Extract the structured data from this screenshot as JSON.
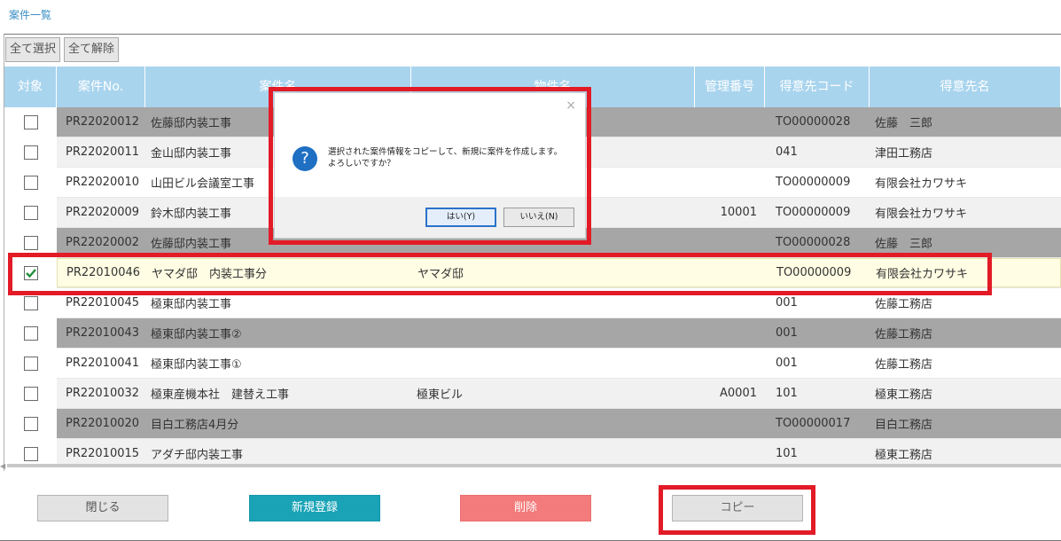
{
  "page_title": "案件一覧",
  "toolbar": {
    "select_all": "全て選択",
    "deselect_all": "全て解除"
  },
  "columns": [
    "対象",
    "案件No.",
    "案件名",
    "物件名",
    "管理番号",
    "得意先コード",
    "得意先名"
  ],
  "rows": [
    {
      "no": "PR22020012",
      "name": "佐藤邸内装工事",
      "property": "",
      "mgmt": "",
      "code": "TO00000028",
      "customer": "佐藤　三郎",
      "checked": false,
      "style": "dark"
    },
    {
      "no": "PR22020011",
      "name": "金山邸内装工事",
      "property": "",
      "mgmt": "",
      "code": "041",
      "customer": "津田工務店",
      "checked": false,
      "style": "light"
    },
    {
      "no": "PR22020010",
      "name": "山田ビル会議室工事",
      "property": "",
      "mgmt": "",
      "code": "TO00000009",
      "customer": "有限会社カワサキ",
      "checked": false,
      "style": "white"
    },
    {
      "no": "PR22020009",
      "name": "鈴木邸内装工事",
      "property": "",
      "mgmt": "10001",
      "code": "TO00000009",
      "customer": "有限会社カワサキ",
      "checked": false,
      "style": "light"
    },
    {
      "no": "PR22020002",
      "name": "佐藤邸内装工事",
      "property": "",
      "mgmt": "",
      "code": "TO00000028",
      "customer": "佐藤　三郎",
      "checked": false,
      "style": "dark"
    },
    {
      "no": "PR22010046",
      "name": "ヤマダ邸　内装工事分",
      "property": "ヤマダ邸",
      "mgmt": "",
      "code": "TO00000009",
      "customer": "有限会社カワサキ",
      "checked": true,
      "style": "sel"
    },
    {
      "no": "PR22010045",
      "name": "極東邸内装工事",
      "property": "",
      "mgmt": "",
      "code": "001",
      "customer": "佐藤工務店",
      "checked": false,
      "style": "white"
    },
    {
      "no": "PR22010043",
      "name": "極東邸内装工事②",
      "property": "",
      "mgmt": "",
      "code": "001",
      "customer": "佐藤工務店",
      "checked": false,
      "style": "dark"
    },
    {
      "no": "PR22010041",
      "name": "極東邸内装工事①",
      "property": "",
      "mgmt": "",
      "code": "001",
      "customer": "佐藤工務店",
      "checked": false,
      "style": "white"
    },
    {
      "no": "PR22010032",
      "name": "極東産機本社　建替え工事",
      "property": "極東ビル",
      "mgmt": "A0001",
      "code": "101",
      "customer": "極東工務店",
      "checked": false,
      "style": "light"
    },
    {
      "no": "PR22010020",
      "name": "目白工務店4月分",
      "property": "",
      "mgmt": "",
      "code": "TO00000017",
      "customer": "目白工務店",
      "checked": false,
      "style": "dark"
    },
    {
      "no": "PR22010015",
      "name": "アダチ邸内装工事",
      "property": "",
      "mgmt": "",
      "code": "101",
      "customer": "極東工務店",
      "checked": false,
      "style": "light"
    }
  ],
  "footer": {
    "close": "閉じる",
    "new": "新規登録",
    "delete": "削除",
    "copy": "コピー"
  },
  "dialog": {
    "message_line1": "選択された案件情報をコピーして、新規に案件を作成します。",
    "message_line2": "よろしいですか？",
    "yes": "はい(Y)",
    "no": "いいえ(N)",
    "icon": "question-icon",
    "close_icon": "×"
  }
}
